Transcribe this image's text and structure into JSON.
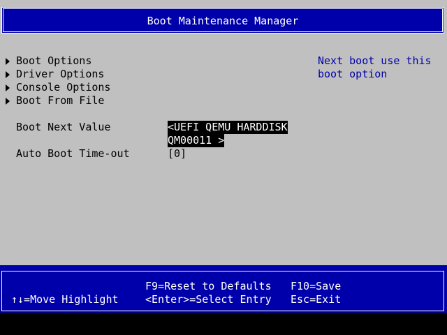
{
  "header": {
    "title": "Boot Maintenance Manager"
  },
  "menu": {
    "items": [
      {
        "label": "Boot Options",
        "icon": "triangle-right-icon"
      },
      {
        "label": "Driver Options",
        "icon": "triangle-right-icon"
      },
      {
        "label": "Console Options",
        "icon": "triangle-right-icon"
      },
      {
        "label": "Boot From File",
        "icon": "triangle-right-icon"
      }
    ]
  },
  "help": {
    "lines": [
      "Next boot use this",
      "boot option"
    ]
  },
  "settings": {
    "boot_next": {
      "label": "Boot Next Value",
      "value_line1": "<UEFI QEMU HARDDISK",
      "value_line2": "QM00011 >"
    },
    "auto_boot": {
      "label": "Auto Boot Time-out",
      "value": "[0]"
    }
  },
  "footer": {
    "move_highlight": "↑↓=Move Highlight",
    "reset_defaults": "F9=Reset to Defaults",
    "select_entry": "<Enter>=Select Entry",
    "save": "F10=Save",
    "exit": "Esc=Exit"
  },
  "colors": {
    "background": "#c0c0c0",
    "frame_blue": "#0000aa",
    "help_text": "#0000aa",
    "highlight_bg": "#000000",
    "highlight_fg": "#ffffff"
  }
}
